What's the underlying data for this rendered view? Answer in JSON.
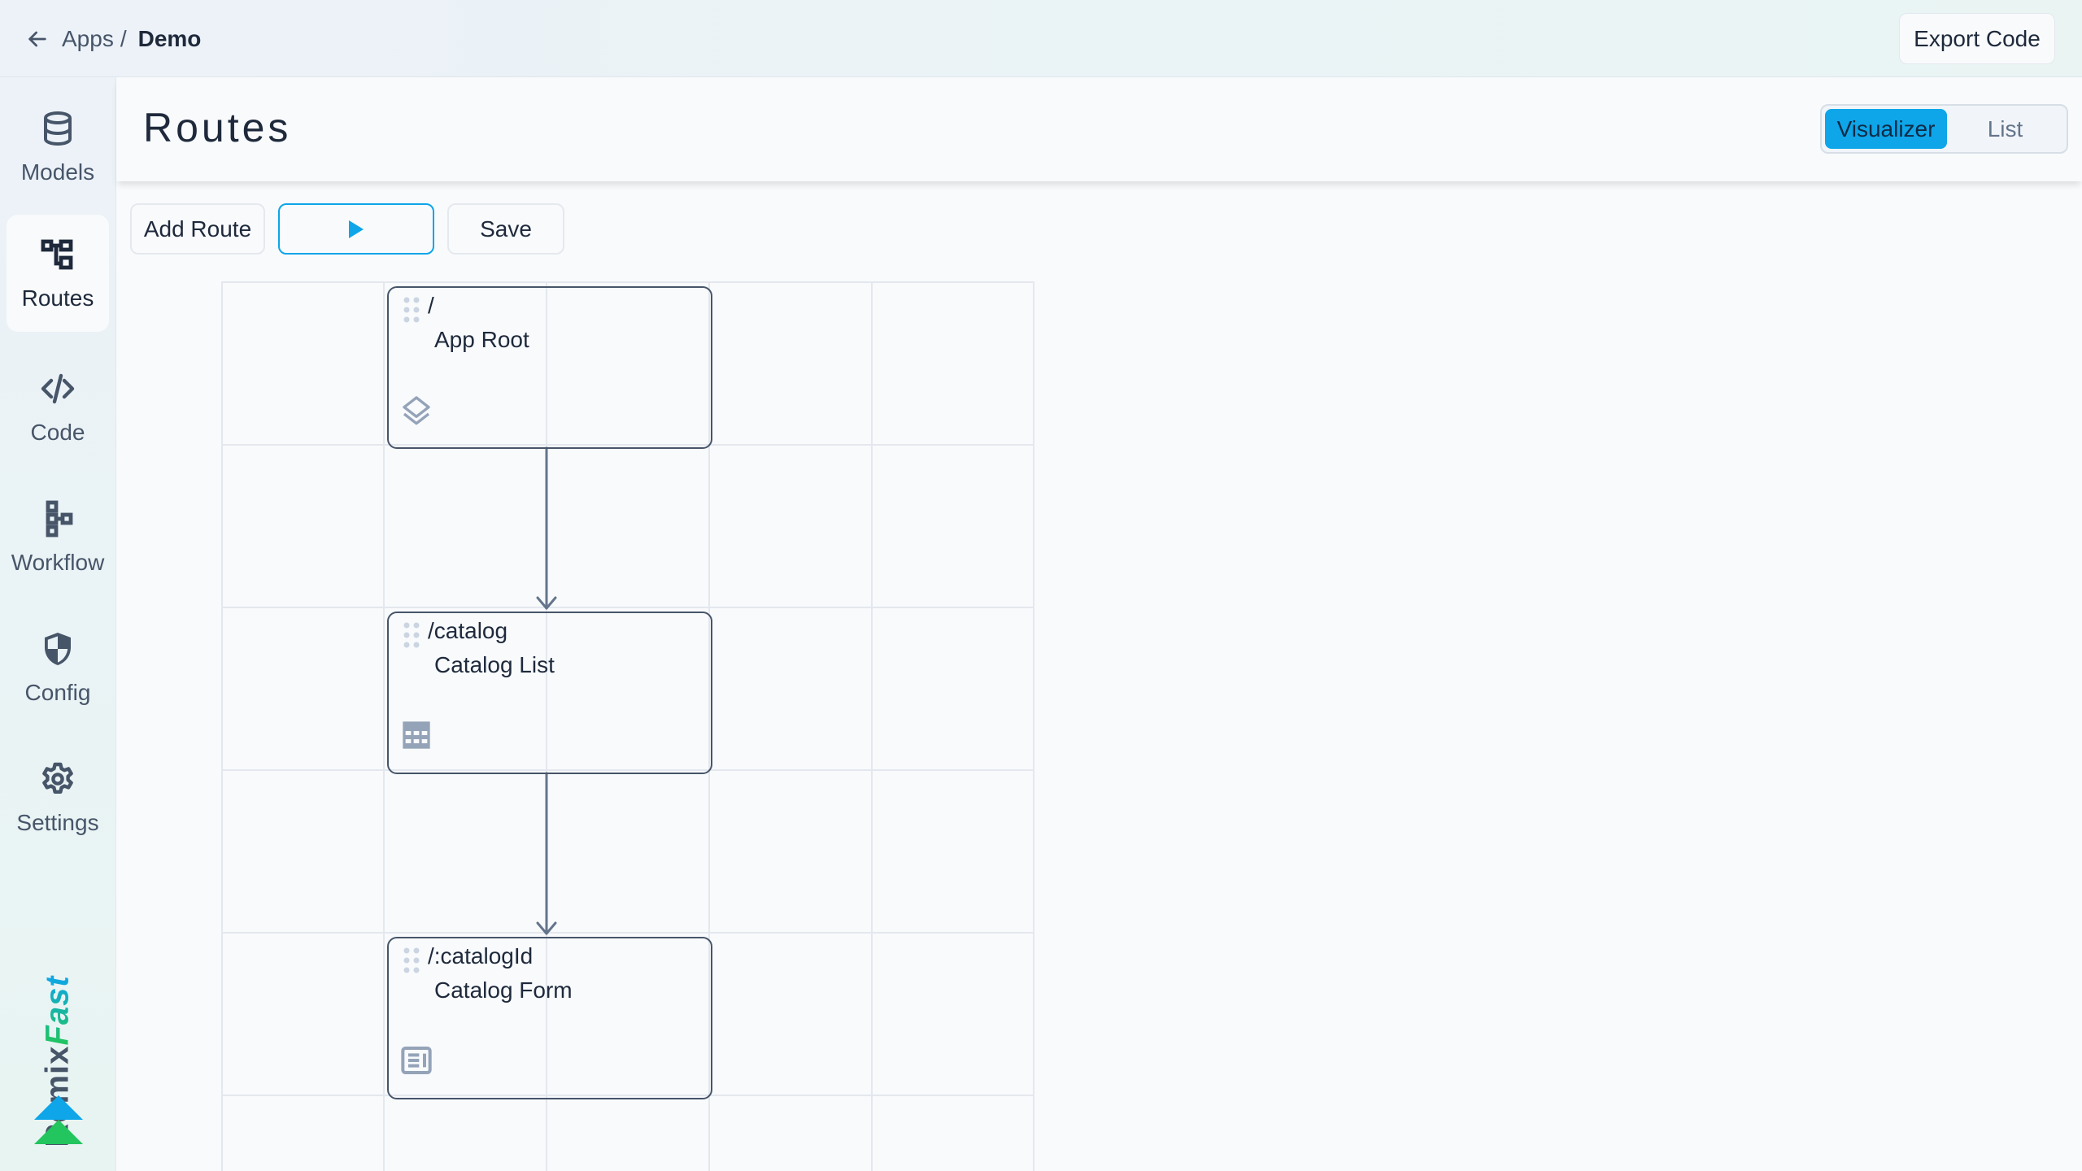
{
  "topbar": {
    "back_icon": "arrow-left-icon",
    "breadcrumb": [
      {
        "label": "Apps"
      },
      {
        "label": "Demo"
      }
    ],
    "separator": "/",
    "export_label": "Export Code"
  },
  "sidebar": {
    "items": [
      {
        "id": "models",
        "label": "Models",
        "icon": "database-icon",
        "active": false
      },
      {
        "id": "routes",
        "label": "Routes",
        "icon": "sitemap-icon",
        "active": true
      },
      {
        "id": "code",
        "label": "Code",
        "icon": "code-icon",
        "active": false
      },
      {
        "id": "workflow",
        "label": "Workflow",
        "icon": "workflow-icon",
        "active": false
      },
      {
        "id": "config",
        "label": "Config",
        "icon": "shield-icon",
        "active": false
      },
      {
        "id": "settings",
        "label": "Settings",
        "icon": "gear-icon",
        "active": false
      }
    ],
    "brand": {
      "part1": "Remix",
      "part2": "Fast"
    },
    "colors": {
      "brand_blue": "#0ea5e9",
      "brand_green": "#22c55e"
    }
  },
  "header": {
    "title": "Routes",
    "view_toggle": {
      "options": [
        "Visualizer",
        "List"
      ],
      "selected": "Visualizer"
    }
  },
  "toolbar": {
    "add_route_label": "Add Route",
    "run_icon": "play-icon",
    "save_label": "Save"
  },
  "routes": [
    {
      "path": "/",
      "name": "App Root",
      "icon": "layers-icon"
    },
    {
      "path": "/catalog",
      "name": "Catalog List",
      "icon": "table-icon"
    },
    {
      "path": "/:catalogId",
      "name": "Catalog Form",
      "icon": "form-icon"
    }
  ],
  "edges": [
    {
      "from": "/",
      "to": "/catalog"
    },
    {
      "from": "/catalog",
      "to": "/:catalogId"
    }
  ],
  "colors": {
    "accent": "#0ea5e9",
    "text": "#1e293b",
    "muted": "#475569",
    "node_border": "#475569",
    "icon_muted": "#94a3b8"
  }
}
